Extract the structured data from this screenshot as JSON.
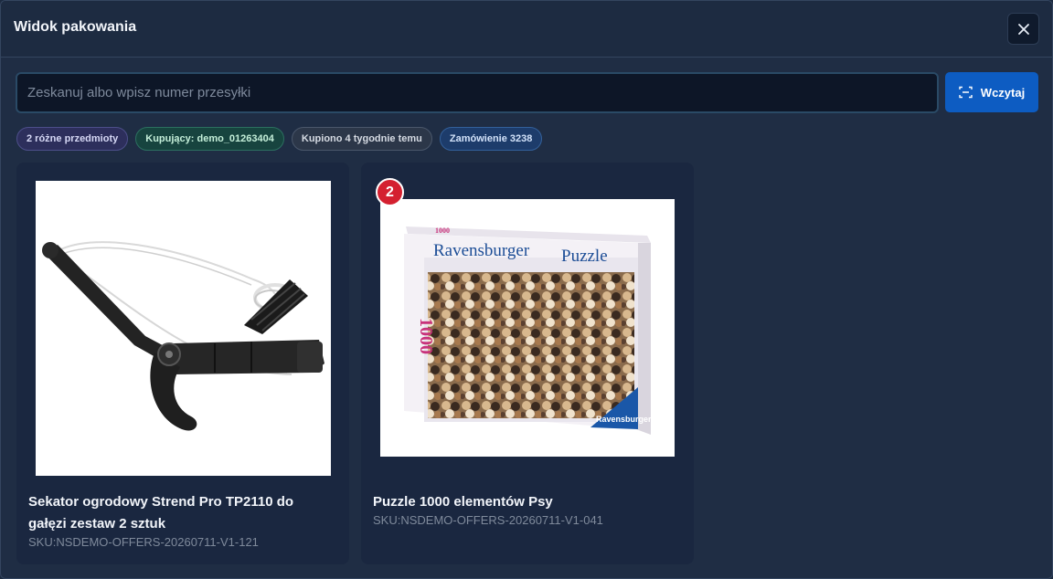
{
  "header": {
    "title": "Widok pakowania",
    "close_icon": "close-icon"
  },
  "scan": {
    "placeholder": "Zeskanuj albo wpisz numer przesyłki",
    "value": "",
    "button_label": "Wczytaj",
    "button_icon": "scan-icon"
  },
  "chips": {
    "items_count": "2 różne przedmioty",
    "buyer": "Kupujący: demo_01263404",
    "purchased": "Kupiono 4 tygodnie temu",
    "order": "Zamówienie 3238"
  },
  "products": [
    {
      "name": "Sekator ogrodowy Strend Pro TP2110 do gałęzi zestaw 2 sztuk",
      "sku": "SKU:NSDEMO-OFFERS-20260711-V1-121",
      "image": "pruner-image"
    },
    {
      "name": "Puzzle 1000 elementów Psy",
      "sku": "SKU:NSDEMO-OFFERS-20260711-V1-041",
      "quantity": "2",
      "image": "puzzle-box-image",
      "box_brand": "Ravensburger",
      "box_title": "Puzzle",
      "box_count": "1000"
    }
  ],
  "colors": {
    "accent": "#0d5cc2",
    "badge": "#d42030",
    "background": "#1f2d44"
  }
}
